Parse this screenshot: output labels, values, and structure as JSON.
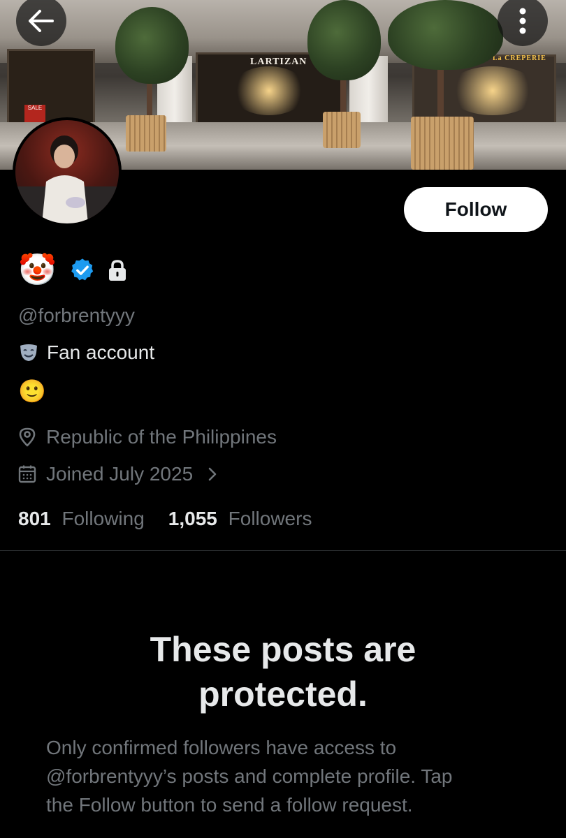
{
  "header": {
    "back_icon": "arrow-left-icon",
    "more_icon": "more-vertical-icon",
    "banner_signs": [
      "LARTIZAN",
      "La CREPERIE",
      "SALE"
    ]
  },
  "profile": {
    "follow_label": "Follow",
    "name_emoji": "🤡",
    "badges": [
      "verified-badge-icon",
      "lock-icon"
    ],
    "handle": "@forbrentyyy",
    "bio_line1_icon": "performing-arts-icon",
    "bio_line1": "Fan account",
    "bio_line2_emoji": "🙂",
    "location": "Republic of the Philippines",
    "joined": "Joined July 2025",
    "following_count": "801",
    "following_label": "Following",
    "followers_count": "1,055",
    "followers_label": "Followers"
  },
  "protected": {
    "title_line1": "These posts are",
    "title_line2": "protected.",
    "body_line1": "Only confirmed followers have access to",
    "body_line2": "@forbrentyyy’s posts and complete profile. Tap",
    "body_line3": "the Follow button to send a follow request."
  },
  "colors": {
    "background": "#000000",
    "primary_text": "#e7e9ea",
    "secondary_text": "#71767b",
    "verified_blue": "#1d9bf0",
    "follow_button_bg": "#ffffff"
  }
}
